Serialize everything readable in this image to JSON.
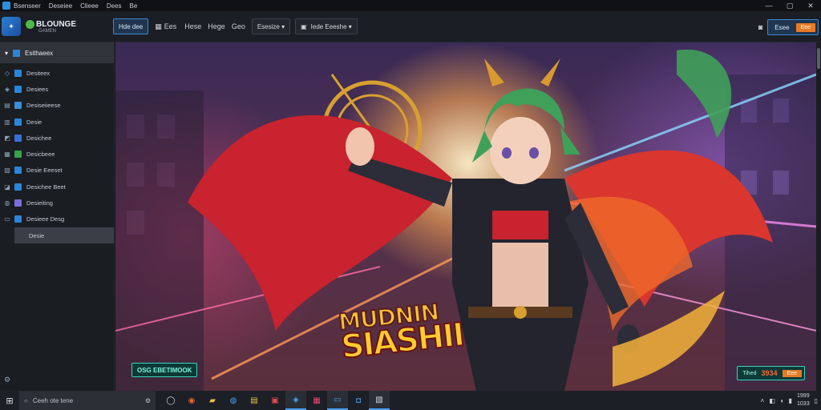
{
  "titlebar": {
    "app_name": "Bsenseer",
    "menu": [
      "Deseiee",
      "Clieee",
      "Dees",
      "Be"
    ],
    "controls": {
      "minimize": "—",
      "maximize": "▢",
      "close": "✕"
    }
  },
  "toolbar": {
    "app_logo_text": "✦",
    "brand_name": "BLOUNGE",
    "brand_sub": "GAMEN",
    "buttons": [
      {
        "label": "Hde dee",
        "primary": true
      },
      {
        "label": "Ees"
      },
      {
        "label": "Hese"
      },
      {
        "label": "Hege"
      },
      {
        "label": "Geo"
      },
      {
        "label": "Esesize ▾"
      },
      {
        "label": "Iede Eeeshe ▾"
      }
    ],
    "upgrade_label": "Esee",
    "upgrade_pill": "Eee"
  },
  "sidebar": {
    "header_label": "Esithaeex",
    "items": [
      {
        "label": "Desiteex",
        "color": "#2b86d8"
      },
      {
        "label": "Desiees",
        "color": "#2b86d8"
      },
      {
        "label": "Desiseiieese",
        "color": "#3a8fd8"
      },
      {
        "label": "Desie",
        "color": "#2b86d8"
      },
      {
        "label": "Desichee",
        "color": "#3b6fd8"
      },
      {
        "label": "Desicbeee",
        "color": "#39a04a"
      },
      {
        "label": "Desie Eeeset",
        "color": "#2b86d8"
      },
      {
        "label": "Desichee Beet",
        "color": "#2b86d8"
      },
      {
        "label": "Desieiting",
        "color": "#7a6fd8"
      },
      {
        "label": "Desieee Desg",
        "color": "#2b86d8"
      },
      {
        "label": "Desie",
        "selected": true
      }
    ]
  },
  "canvas": {
    "logo_line1": "MUDNIN",
    "logo_line2": "SIASHII",
    "badge_left": "OSG EBETIMOOK",
    "badge_right_label": "Tihed",
    "badge_right_count": "3934",
    "badge_right_pill": "Eee"
  },
  "taskbar": {
    "search_placeholder": "Ceeh ote tene",
    "tray_time": "1999",
    "tray_date": "1033"
  }
}
